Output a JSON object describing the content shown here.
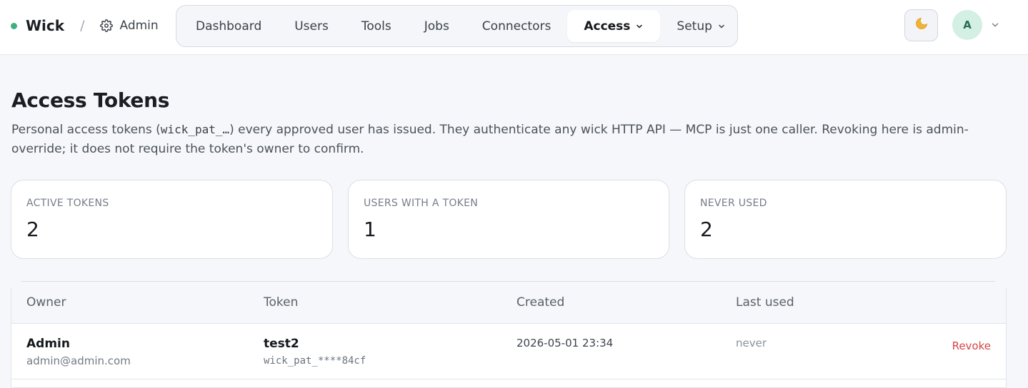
{
  "brand": {
    "name": "Wick",
    "separator": "/",
    "area": "Admin"
  },
  "nav": {
    "items": [
      {
        "label": "Dashboard"
      },
      {
        "label": "Users"
      },
      {
        "label": "Tools"
      },
      {
        "label": "Jobs"
      },
      {
        "label": "Connectors"
      },
      {
        "label": "Access",
        "active": true,
        "dropdown": true
      },
      {
        "label": "Setup",
        "dropdown": true
      }
    ]
  },
  "header_right": {
    "theme_icon": "moon-icon",
    "avatar_initial": "A"
  },
  "page": {
    "title": "Access Tokens",
    "desc_before": "Personal access tokens (",
    "desc_code": "wick_pat_…",
    "desc_after": ") every approved user has issued. They authenticate any wick HTTP API — MCP is just one caller. Revoking here is admin-override; it does not require the token's owner to confirm."
  },
  "stats": [
    {
      "label": "ACTIVE TOKENS",
      "value": "2"
    },
    {
      "label": "USERS WITH A TOKEN",
      "value": "1"
    },
    {
      "label": "NEVER USED",
      "value": "2"
    }
  ],
  "table": {
    "columns": [
      "Owner",
      "Token",
      "Created",
      "Last used"
    ],
    "rows": [
      {
        "owner_name": "Admin",
        "owner_email": "admin@admin.com",
        "token_name": "test2",
        "token_mask": "wick_pat_****84cf",
        "created": "2026-05-01 23:34",
        "last_used": "never",
        "action": "Revoke"
      }
    ]
  },
  "colors": {
    "accent_green": "#3fb07f",
    "danger": "#d64545",
    "avatar_bg": "#d4efe4"
  }
}
